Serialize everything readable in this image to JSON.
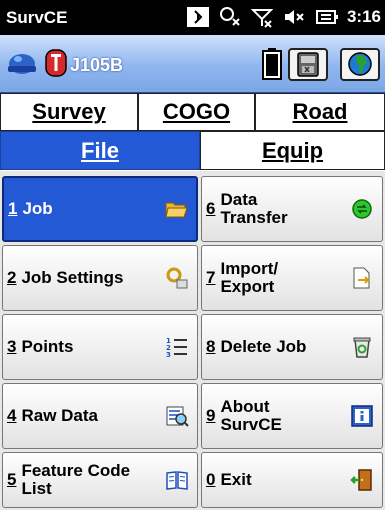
{
  "statusbar": {
    "title": "SurvCE",
    "time": "3:16"
  },
  "toolbar": {
    "job_name": "J105B"
  },
  "tabs": {
    "survey": "Survey",
    "cogo": "COGO",
    "road": "Road",
    "file": "File",
    "equip": "Equip"
  },
  "menu": [
    {
      "num": "1",
      "label": "Job"
    },
    {
      "num": "2",
      "label": "Job Settings"
    },
    {
      "num": "3",
      "label": "Points"
    },
    {
      "num": "4",
      "label": "Raw Data"
    },
    {
      "num": "5",
      "label": "Feature Code List"
    },
    {
      "num": "6",
      "label": "Data Transfer"
    },
    {
      "num": "7",
      "label": "Import/ Export"
    },
    {
      "num": "8",
      "label": "Delete Job"
    },
    {
      "num": "9",
      "label": "About SurvCE"
    },
    {
      "num": "0",
      "label": "Exit"
    }
  ],
  "colors": {
    "accent": "#2459d6",
    "toolbar": "#8fb6ef"
  }
}
